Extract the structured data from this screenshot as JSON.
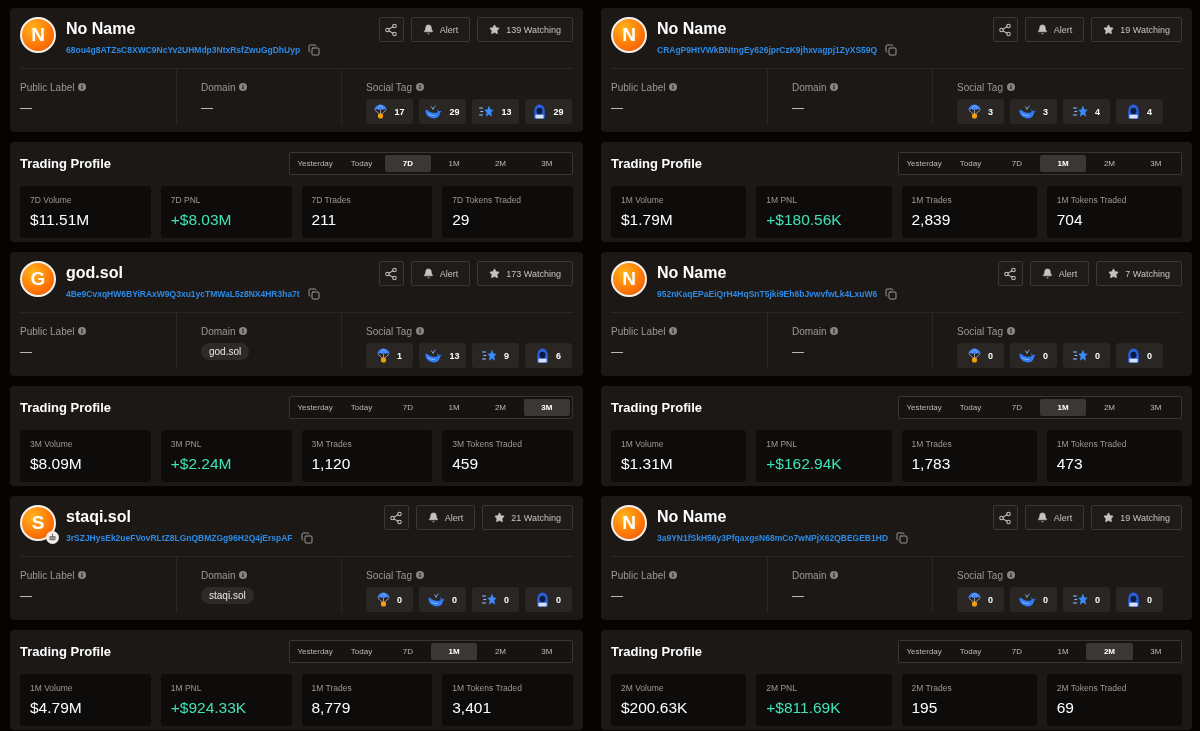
{
  "panels": [
    {
      "profile": {
        "avatar_letter": "N",
        "bot_badge": false,
        "name": "No Name",
        "address": "68ou4g8ATZsC8XWC9NcYv2UHMdp3NtxRsfZwuGgDhUyp",
        "actions": {
          "alert": "Alert",
          "watching": "139 Watching"
        },
        "public_label": {
          "label": "Public Label",
          "value": "—"
        },
        "domain": {
          "label": "Domain",
          "kind": "dash",
          "value": "—"
        },
        "social_tag": {
          "label": "Social Tag",
          "tags": [
            {
              "kind": "airdrop",
              "count": "17"
            },
            {
              "kind": "whale",
              "count": "29"
            },
            {
              "kind": "star",
              "count": "13"
            },
            {
              "kind": "hacker",
              "count": "29"
            }
          ]
        }
      },
      "trading": {
        "title": "Trading Profile",
        "tabs": [
          {
            "label": "Yesterday",
            "selected": false
          },
          {
            "label": "Today",
            "selected": false
          },
          {
            "label": "7D",
            "selected": true
          },
          {
            "label": "1M",
            "selected": false
          },
          {
            "label": "2M",
            "selected": false
          },
          {
            "label": "3M",
            "selected": false
          }
        ],
        "stats": [
          {
            "label": "7D Volume",
            "value": "$11.51M",
            "kind": "plain"
          },
          {
            "label": "7D PNL",
            "value": "+$8.03M",
            "kind": "gain"
          },
          {
            "label": "7D Trades",
            "value": "211",
            "kind": "plain"
          },
          {
            "label": "7D Tokens Traded",
            "value": "29",
            "kind": "plain"
          }
        ]
      }
    },
    {
      "profile": {
        "avatar_letter": "N",
        "bot_badge": false,
        "name": "No Name",
        "address": "CRAgP9HtVWkBNtngEy626jprCzK9jhxvagpj1ZyXS59Q",
        "actions": {
          "alert": "Alert",
          "watching": "19 Watching"
        },
        "public_label": {
          "label": "Public Label",
          "value": "—"
        },
        "domain": {
          "label": "Domain",
          "kind": "dash",
          "value": "—"
        },
        "social_tag": {
          "label": "Social Tag",
          "tags": [
            {
              "kind": "airdrop",
              "count": "3"
            },
            {
              "kind": "whale",
              "count": "3"
            },
            {
              "kind": "star",
              "count": "4"
            },
            {
              "kind": "hacker",
              "count": "4"
            }
          ]
        }
      },
      "trading": {
        "title": "Trading Profile",
        "tabs": [
          {
            "label": "Yesterday",
            "selected": false
          },
          {
            "label": "Today",
            "selected": false
          },
          {
            "label": "7D",
            "selected": false
          },
          {
            "label": "1M",
            "selected": true
          },
          {
            "label": "2M",
            "selected": false
          },
          {
            "label": "3M",
            "selected": false
          }
        ],
        "stats": [
          {
            "label": "1M Volume",
            "value": "$1.79M",
            "kind": "plain"
          },
          {
            "label": "1M PNL",
            "value": "+$180.56K",
            "kind": "gain"
          },
          {
            "label": "1M Trades",
            "value": "2,839",
            "kind": "plain"
          },
          {
            "label": "1M Tokens Traded",
            "value": "704",
            "kind": "plain"
          }
        ]
      }
    },
    {
      "profile": {
        "avatar_letter": "G",
        "bot_badge": false,
        "name": "god.sol",
        "address": "4Be9CvxqHW6BYiRAxW9Q3xu1ycTMWaL5z8NX4HR3ha7t",
        "actions": {
          "alert": "Alert",
          "watching": "173 Watching"
        },
        "public_label": {
          "label": "Public Label",
          "value": "—"
        },
        "domain": {
          "label": "Domain",
          "kind": "chip",
          "value": "god.sol"
        },
        "social_tag": {
          "label": "Social Tag",
          "tags": [
            {
              "kind": "airdrop",
              "count": "1"
            },
            {
              "kind": "whale",
              "count": "13"
            },
            {
              "kind": "star",
              "count": "9"
            },
            {
              "kind": "hacker",
              "count": "6"
            }
          ]
        }
      },
      "trading": {
        "title": "Trading Profile",
        "tabs": [
          {
            "label": "Yesterday",
            "selected": false
          },
          {
            "label": "Today",
            "selected": false
          },
          {
            "label": "7D",
            "selected": false
          },
          {
            "label": "1M",
            "selected": false
          },
          {
            "label": "2M",
            "selected": false
          },
          {
            "label": "3M",
            "selected": true
          }
        ],
        "stats": [
          {
            "label": "3M Volume",
            "value": "$8.09M",
            "kind": "plain"
          },
          {
            "label": "3M PNL",
            "value": "+$2.24M",
            "kind": "gain"
          },
          {
            "label": "3M Trades",
            "value": "1,120",
            "kind": "plain"
          },
          {
            "label": "3M Tokens Traded",
            "value": "459",
            "kind": "plain"
          }
        ]
      }
    },
    {
      "profile": {
        "avatar_letter": "N",
        "bot_badge": false,
        "name": "No Name",
        "address": "952nKaqEPaEiQrH4HqSnT5jki9Eh6bJvwvfwLk4LxuW6",
        "actions": {
          "alert": "Alert",
          "watching": "7 Watching"
        },
        "public_label": {
          "label": "Public Label",
          "value": "—"
        },
        "domain": {
          "label": "Domain",
          "kind": "dash",
          "value": "—"
        },
        "social_tag": {
          "label": "Social Tag",
          "tags": [
            {
              "kind": "airdrop",
              "count": "0"
            },
            {
              "kind": "whale",
              "count": "0"
            },
            {
              "kind": "star",
              "count": "0"
            },
            {
              "kind": "hacker",
              "count": "0"
            }
          ]
        }
      },
      "trading": {
        "title": "Trading Profile",
        "tabs": [
          {
            "label": "Yesterday",
            "selected": false
          },
          {
            "label": "Today",
            "selected": false
          },
          {
            "label": "7D",
            "selected": false
          },
          {
            "label": "1M",
            "selected": true
          },
          {
            "label": "2M",
            "selected": false
          },
          {
            "label": "3M",
            "selected": false
          }
        ],
        "stats": [
          {
            "label": "1M Volume",
            "value": "$1.31M",
            "kind": "plain"
          },
          {
            "label": "1M PNL",
            "value": "+$162.94K",
            "kind": "gain"
          },
          {
            "label": "1M Trades",
            "value": "1,783",
            "kind": "plain"
          },
          {
            "label": "1M Tokens Traded",
            "value": "473",
            "kind": "plain"
          }
        ]
      }
    },
    {
      "profile": {
        "avatar_letter": "S",
        "bot_badge": true,
        "name": "staqi.sol",
        "address": "3rSZJHysEk2ueFVovRLtZ8LGnQBMZGg96H2Q4jErspAF",
        "actions": {
          "alert": "Alert",
          "watching": "21 Watching"
        },
        "public_label": {
          "label": "Public Label",
          "value": "—"
        },
        "domain": {
          "label": "Domain",
          "kind": "chip",
          "value": "staqi.sol"
        },
        "social_tag": {
          "label": "Social Tag",
          "tags": [
            {
              "kind": "airdrop",
              "count": "0"
            },
            {
              "kind": "whale",
              "count": "0"
            },
            {
              "kind": "star",
              "count": "0"
            },
            {
              "kind": "hacker",
              "count": "0"
            }
          ]
        }
      },
      "trading": {
        "title": "Trading Profile",
        "tabs": [
          {
            "label": "Yesterday",
            "selected": false
          },
          {
            "label": "Today",
            "selected": false
          },
          {
            "label": "7D",
            "selected": false
          },
          {
            "label": "1M",
            "selected": true
          },
          {
            "label": "2M",
            "selected": false
          },
          {
            "label": "3M",
            "selected": false
          }
        ],
        "stats": [
          {
            "label": "1M Volume",
            "value": "$4.79M",
            "kind": "plain"
          },
          {
            "label": "1M PNL",
            "value": "+$924.33K",
            "kind": "gain"
          },
          {
            "label": "1M Trades",
            "value": "8,779",
            "kind": "plain"
          },
          {
            "label": "1M Tokens Traded",
            "value": "3,401",
            "kind": "plain"
          }
        ]
      }
    },
    {
      "profile": {
        "avatar_letter": "N",
        "bot_badge": false,
        "name": "No Name",
        "address": "3a9YN1fSkH56y3PfqaxgsN68mCo7wNPjX62QBEGEB1HD",
        "actions": {
          "alert": "Alert",
          "watching": "19 Watching"
        },
        "public_label": {
          "label": "Public Label",
          "value": "—"
        },
        "domain": {
          "label": "Domain",
          "kind": "dash",
          "value": "—"
        },
        "social_tag": {
          "label": "Social Tag",
          "tags": [
            {
              "kind": "airdrop",
              "count": "0"
            },
            {
              "kind": "whale",
              "count": "0"
            },
            {
              "kind": "star",
              "count": "0"
            },
            {
              "kind": "hacker",
              "count": "0"
            }
          ]
        }
      },
      "trading": {
        "title": "Trading Profile",
        "tabs": [
          {
            "label": "Yesterday",
            "selected": false
          },
          {
            "label": "Today",
            "selected": false
          },
          {
            "label": "7D",
            "selected": false
          },
          {
            "label": "1M",
            "selected": false
          },
          {
            "label": "2M",
            "selected": true
          },
          {
            "label": "3M",
            "selected": false
          }
        ],
        "stats": [
          {
            "label": "2M Volume",
            "value": "$200.63K",
            "kind": "plain"
          },
          {
            "label": "2M PNL",
            "value": "+$811.69K",
            "kind": "gain"
          },
          {
            "label": "2M Trades",
            "value": "195",
            "kind": "plain"
          },
          {
            "label": "2M Tokens Traded",
            "value": "69",
            "kind": "plain"
          }
        ]
      }
    }
  ]
}
